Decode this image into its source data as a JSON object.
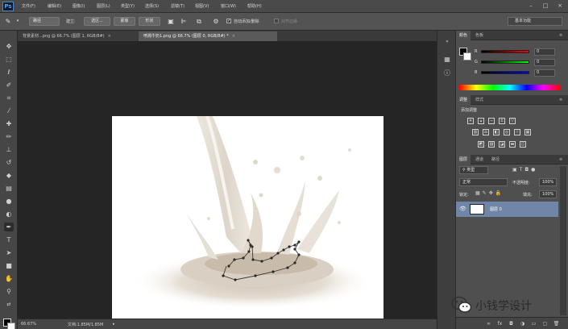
{
  "app": {
    "logo": "Ps"
  },
  "menu": [
    "文件(F)",
    "编辑(E)",
    "图像(I)",
    "图层(L)",
    "类型(Y)",
    "选择(S)",
    "滤镜(T)",
    "视图(V)",
    "窗口(W)",
    "帮助(H)"
  ],
  "window_controls": [
    "–",
    "□",
    "×"
  ],
  "options": {
    "mode_value": "路径",
    "create_label": "建立:",
    "selection_btn": "选区...",
    "mask_btn": "蒙版",
    "shape_btn": "形状",
    "auto_add_delete_label": "自动添加/删除",
    "align_edges_label": "对齐边缘",
    "workspace": "基本功能"
  },
  "tabs": [
    {
      "label": "背景素材...png @ 66.7% (图层 1, RGB/8#)",
      "close": "×",
      "active": false
    },
    {
      "label": "喷溅牛奶1.png @ 66.7% (图层 0, RGB/8#) *",
      "close": "×",
      "active": true
    }
  ],
  "status": {
    "zoom": "66.67%",
    "doc": "文档:1.85M/1.85M"
  },
  "color_panel": {
    "tabs": [
      "颜色",
      "色板"
    ],
    "channels": [
      {
        "label": "R",
        "value": "0",
        "color": "#d03030"
      },
      {
        "label": "G",
        "value": "0",
        "color": "#30b030"
      },
      {
        "label": "B",
        "value": "0",
        "color": "#3050d0"
      }
    ]
  },
  "adjust_panel": {
    "tabs": [
      "调整",
      "样式"
    ],
    "title": "添加调整"
  },
  "layers_panel": {
    "tabs": [
      "图层",
      "通道",
      "路径"
    ],
    "filter_kind": "类型",
    "blend_mode": "正常",
    "opacity_label": "不透明度:",
    "opacity": "100%",
    "lock_label": "锁定:",
    "fill_label": "填充:",
    "fill": "100%",
    "layers": [
      {
        "name": "图层 0"
      }
    ]
  },
  "watermark": {
    "text": "小钱学设计"
  },
  "colors": {
    "accent": "#6f86a8",
    "ps_blue": "#4a86c8"
  }
}
